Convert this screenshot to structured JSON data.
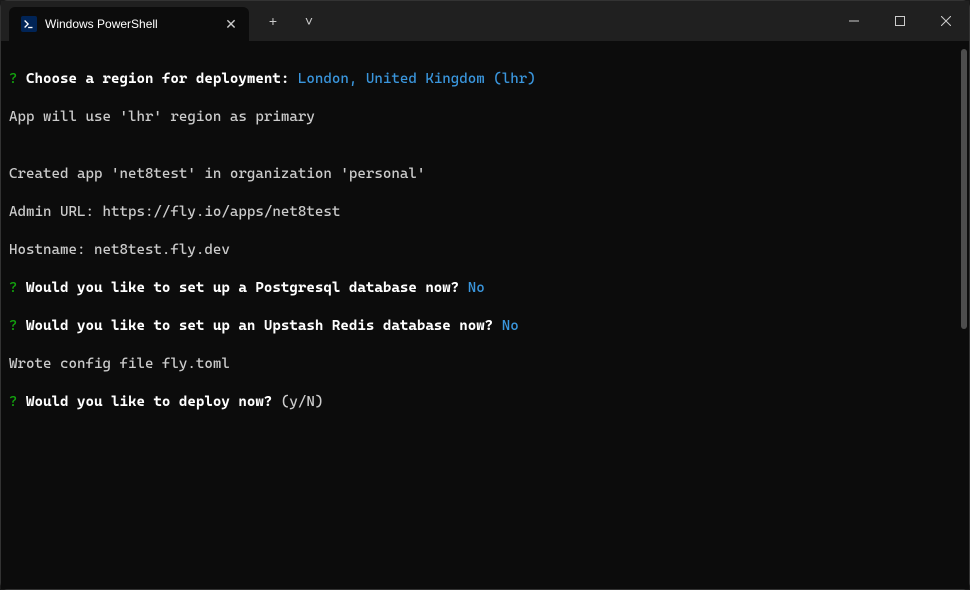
{
  "titlebar": {
    "tab_title": "Windows PowerShell",
    "tab_icon_glyph": ">_",
    "close_glyph": "✕",
    "new_tab_glyph": "+",
    "dropdown_glyph": "˅"
  },
  "window_controls": {
    "minimize": "—",
    "maximize": "□",
    "close": "✕"
  },
  "terminal": {
    "prompt_marker": "?",
    "lines": {
      "q1_label": " Choose a region for deployment: ",
      "q1_answer": "London, United Kingdom (lhr)",
      "l2": "App will use 'lhr' region as primary",
      "l3": "",
      "l4": "Created app 'net8test' in organization 'personal'",
      "l5": "Admin URL: https://fly.io/apps/net8test",
      "l6": "Hostname: net8test.fly.dev",
      "q2_label": " Would you like to set up a Postgresql database now? ",
      "q2_answer": "No",
      "q3_label": " Would you like to set up an Upstash Redis database now? ",
      "q3_answer": "No",
      "l9": "Wrote config file fly.toml",
      "q4_label": " Would you like to deploy now? ",
      "q4_hint": "(y/N) "
    }
  }
}
